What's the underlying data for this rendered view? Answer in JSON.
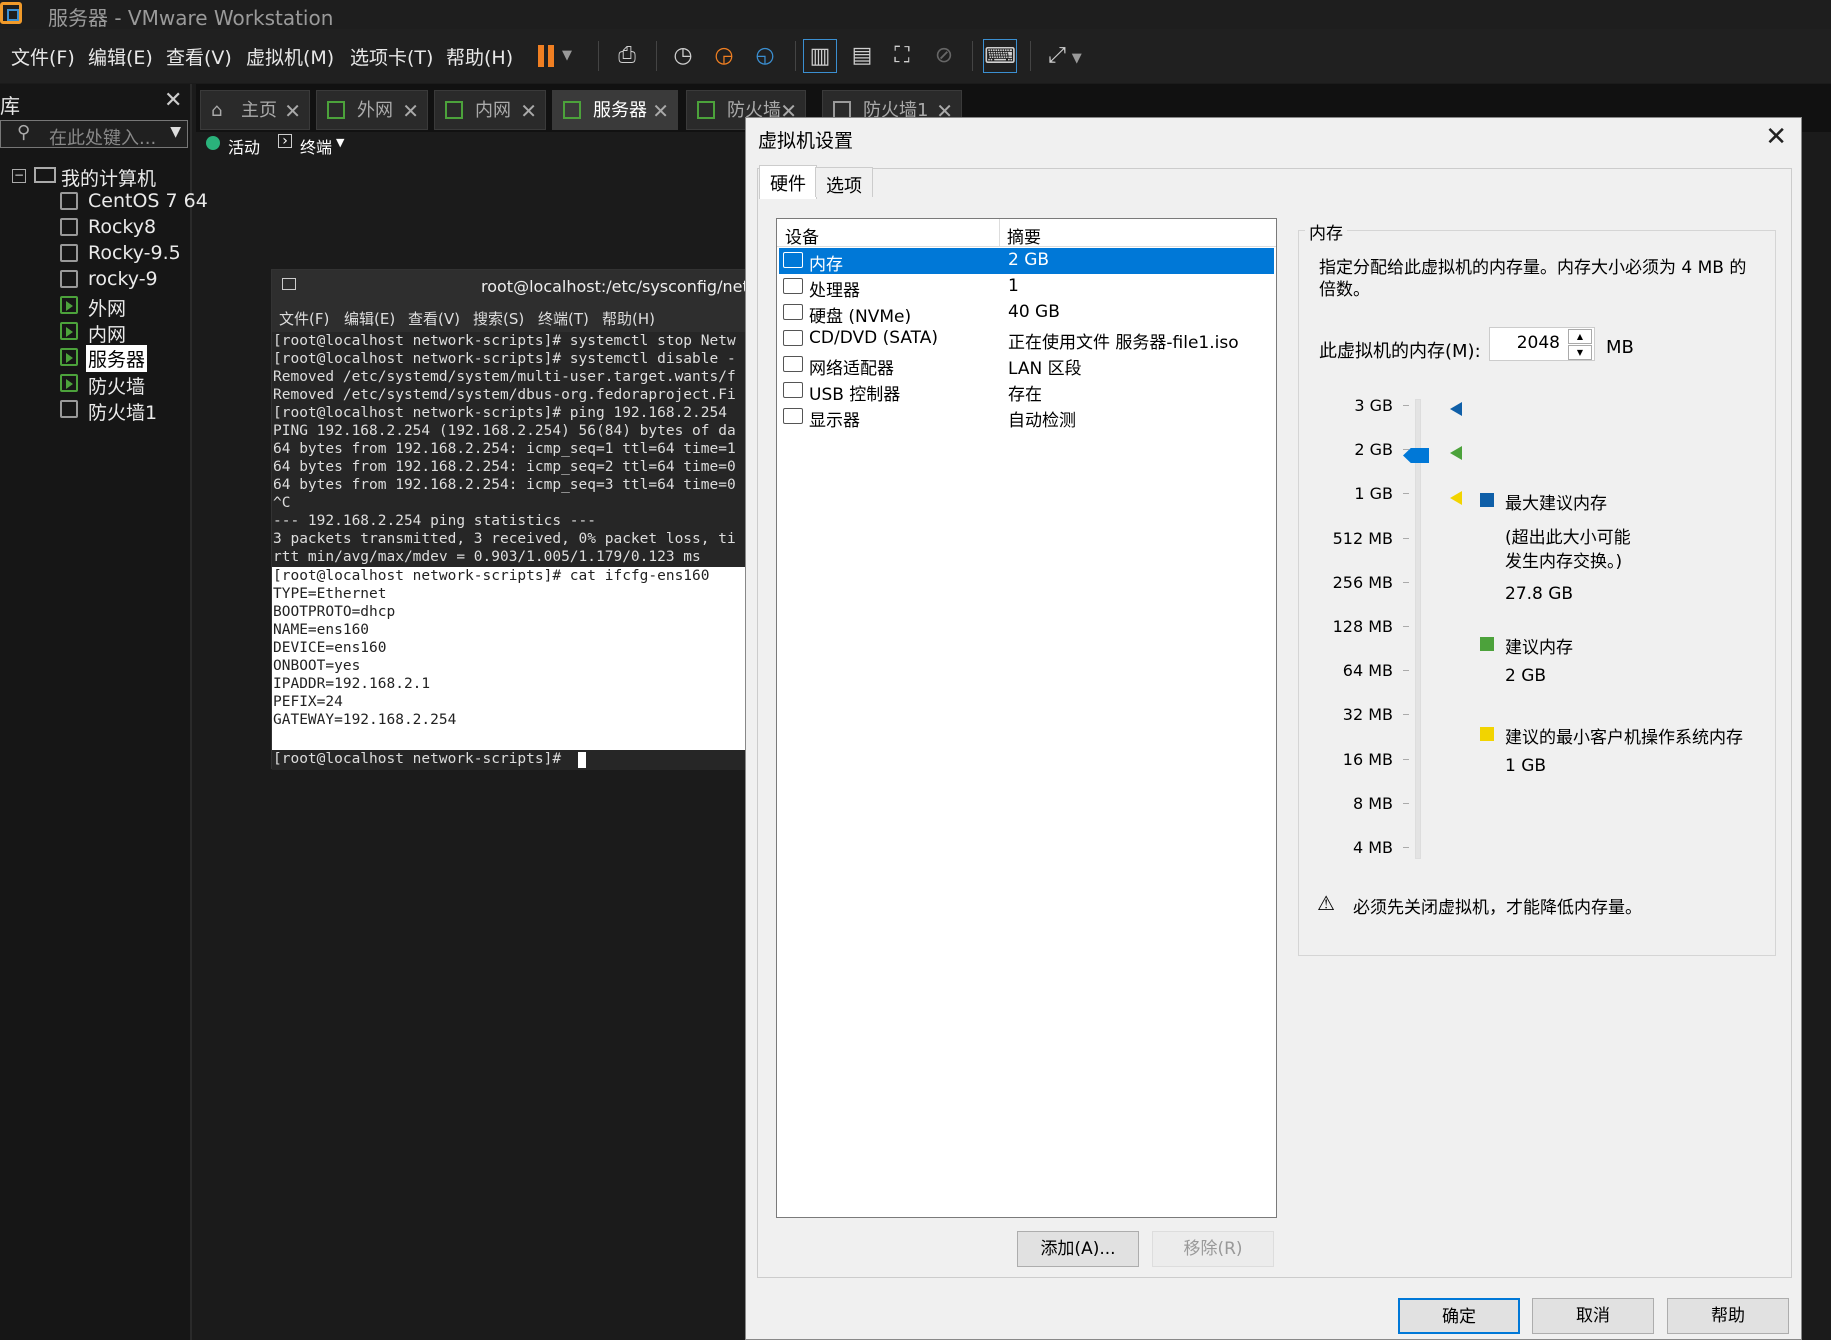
{
  "window": {
    "title": "服务器 - VMware Workstation"
  },
  "menu": [
    "文件(F)",
    "编辑(E)",
    "查看(V)",
    "虚拟机(M)",
    "选项卡(T)",
    "帮助(H)"
  ],
  "library": {
    "title": "库",
    "search_placeholder": "在此处键入...",
    "root": "我的计算机",
    "items": [
      "CentOS 7 64",
      "Rocky8",
      "Rocky-9.5",
      "rocky-9",
      "外网",
      "内网",
      "服务器",
      "防火墙",
      "防火墙1"
    ],
    "selected": "服务器"
  },
  "tabs": [
    "主页",
    "外网",
    "内网",
    "服务器",
    "防火墙",
    "防火墙1"
  ],
  "active_tab": "服务器",
  "vm_status": {
    "activity": "活动",
    "terminal": "终端"
  },
  "terminal": {
    "title": "root@localhost:/etc/sysconfig/network-",
    "menu": [
      "文件(F)",
      "编辑(E)",
      "查看(V)",
      "搜索(S)",
      "终端(T)",
      "帮助(H)"
    ],
    "dark_lines": [
      "[root@localhost network-scripts]# systemctl stop Netw",
      "[root@localhost network-scripts]# systemctl disable -",
      "Removed /etc/systemd/system/multi-user.target.wants/f",
      "Removed /etc/systemd/system/dbus-org.fedoraproject.Fi",
      "[root@localhost network-scripts]# ping 192.168.2.254",
      "PING 192.168.2.254 (192.168.2.254) 56(84) bytes of da",
      "64 bytes from 192.168.2.254: icmp_seq=1 ttl=64 time=1",
      "64 bytes from 192.168.2.254: icmp_seq=2 ttl=64 time=0",
      "64 bytes from 192.168.2.254: icmp_seq=3 ttl=64 time=0",
      "^C",
      "--- 192.168.2.254 ping statistics ---",
      "3 packets transmitted, 3 received, 0% packet loss, ti",
      "rtt min/avg/max/mdev = 0.903/1.005/1.179/0.123 ms"
    ],
    "light_lines": [
      "[root@localhost network-scripts]# cat ifcfg-ens160",
      "TYPE=Ethernet",
      "BOOTPROTO=dhcp",
      "NAME=ens160",
      "DEVICE=ens160",
      "ONBOOT=yes",
      "IPADDR=192.168.2.1",
      "PEFIX=24",
      "GATEWAY=192.168.2.254"
    ],
    "prompt": "[root@localhost network-scripts]# "
  },
  "dialog": {
    "title": "虚拟机设置",
    "tabs": [
      "硬件",
      "选项"
    ],
    "columns": [
      "设备",
      "摘要"
    ],
    "devices": [
      {
        "name": "内存",
        "summary": "2 GB",
        "icon": "memory-icon"
      },
      {
        "name": "处理器",
        "summary": "1",
        "icon": "cpu-icon"
      },
      {
        "name": "硬盘 (NVMe)",
        "summary": "40 GB",
        "icon": "harddisk-icon"
      },
      {
        "name": "CD/DVD (SATA)",
        "summary": "正在使用文件 服务器-file1.iso",
        "icon": "cd-icon"
      },
      {
        "name": "网络适配器",
        "summary": "LAN 区段",
        "icon": "network-icon"
      },
      {
        "name": "USB 控制器",
        "summary": "存在",
        "icon": "usb-icon"
      },
      {
        "name": "显示器",
        "summary": "自动检测",
        "icon": "display-icon"
      }
    ],
    "add_button": "添加(A)...",
    "remove_button": "移除(R)",
    "ok": "确定",
    "cancel": "取消",
    "help": "帮助",
    "memory": {
      "group_title": "内存",
      "description": "指定分配给此虚拟机的内存量。内存大小必须为 4 MB 的倍数。",
      "input_label": "此虚拟机的内存(M):",
      "value": "2048",
      "unit": "MB",
      "scale": [
        "3 GB",
        "2 GB",
        "1 GB",
        "512 MB",
        "256 MB",
        "128 MB",
        "64 MB",
        "32 MB",
        "16 MB",
        "8 MB",
        "4 MB"
      ],
      "max_recommended_label": "最大建议内存",
      "max_recommended_note1": "(超出此大小可能",
      "max_recommended_note2": "发生内存交换。)",
      "max_recommended_value": "27.8 GB",
      "recommended_label": "建议内存",
      "recommended_value": "2 GB",
      "min_label": "建议的最小客户机操作系统内存",
      "min_value": "1 GB",
      "warning": "必须先关闭虚拟机，才能降低内存量。",
      "colors": {
        "max": "#0f5fa8",
        "recommended": "#4ca23b",
        "min": "#f2d400",
        "slider": "#0078d7"
      }
    }
  }
}
